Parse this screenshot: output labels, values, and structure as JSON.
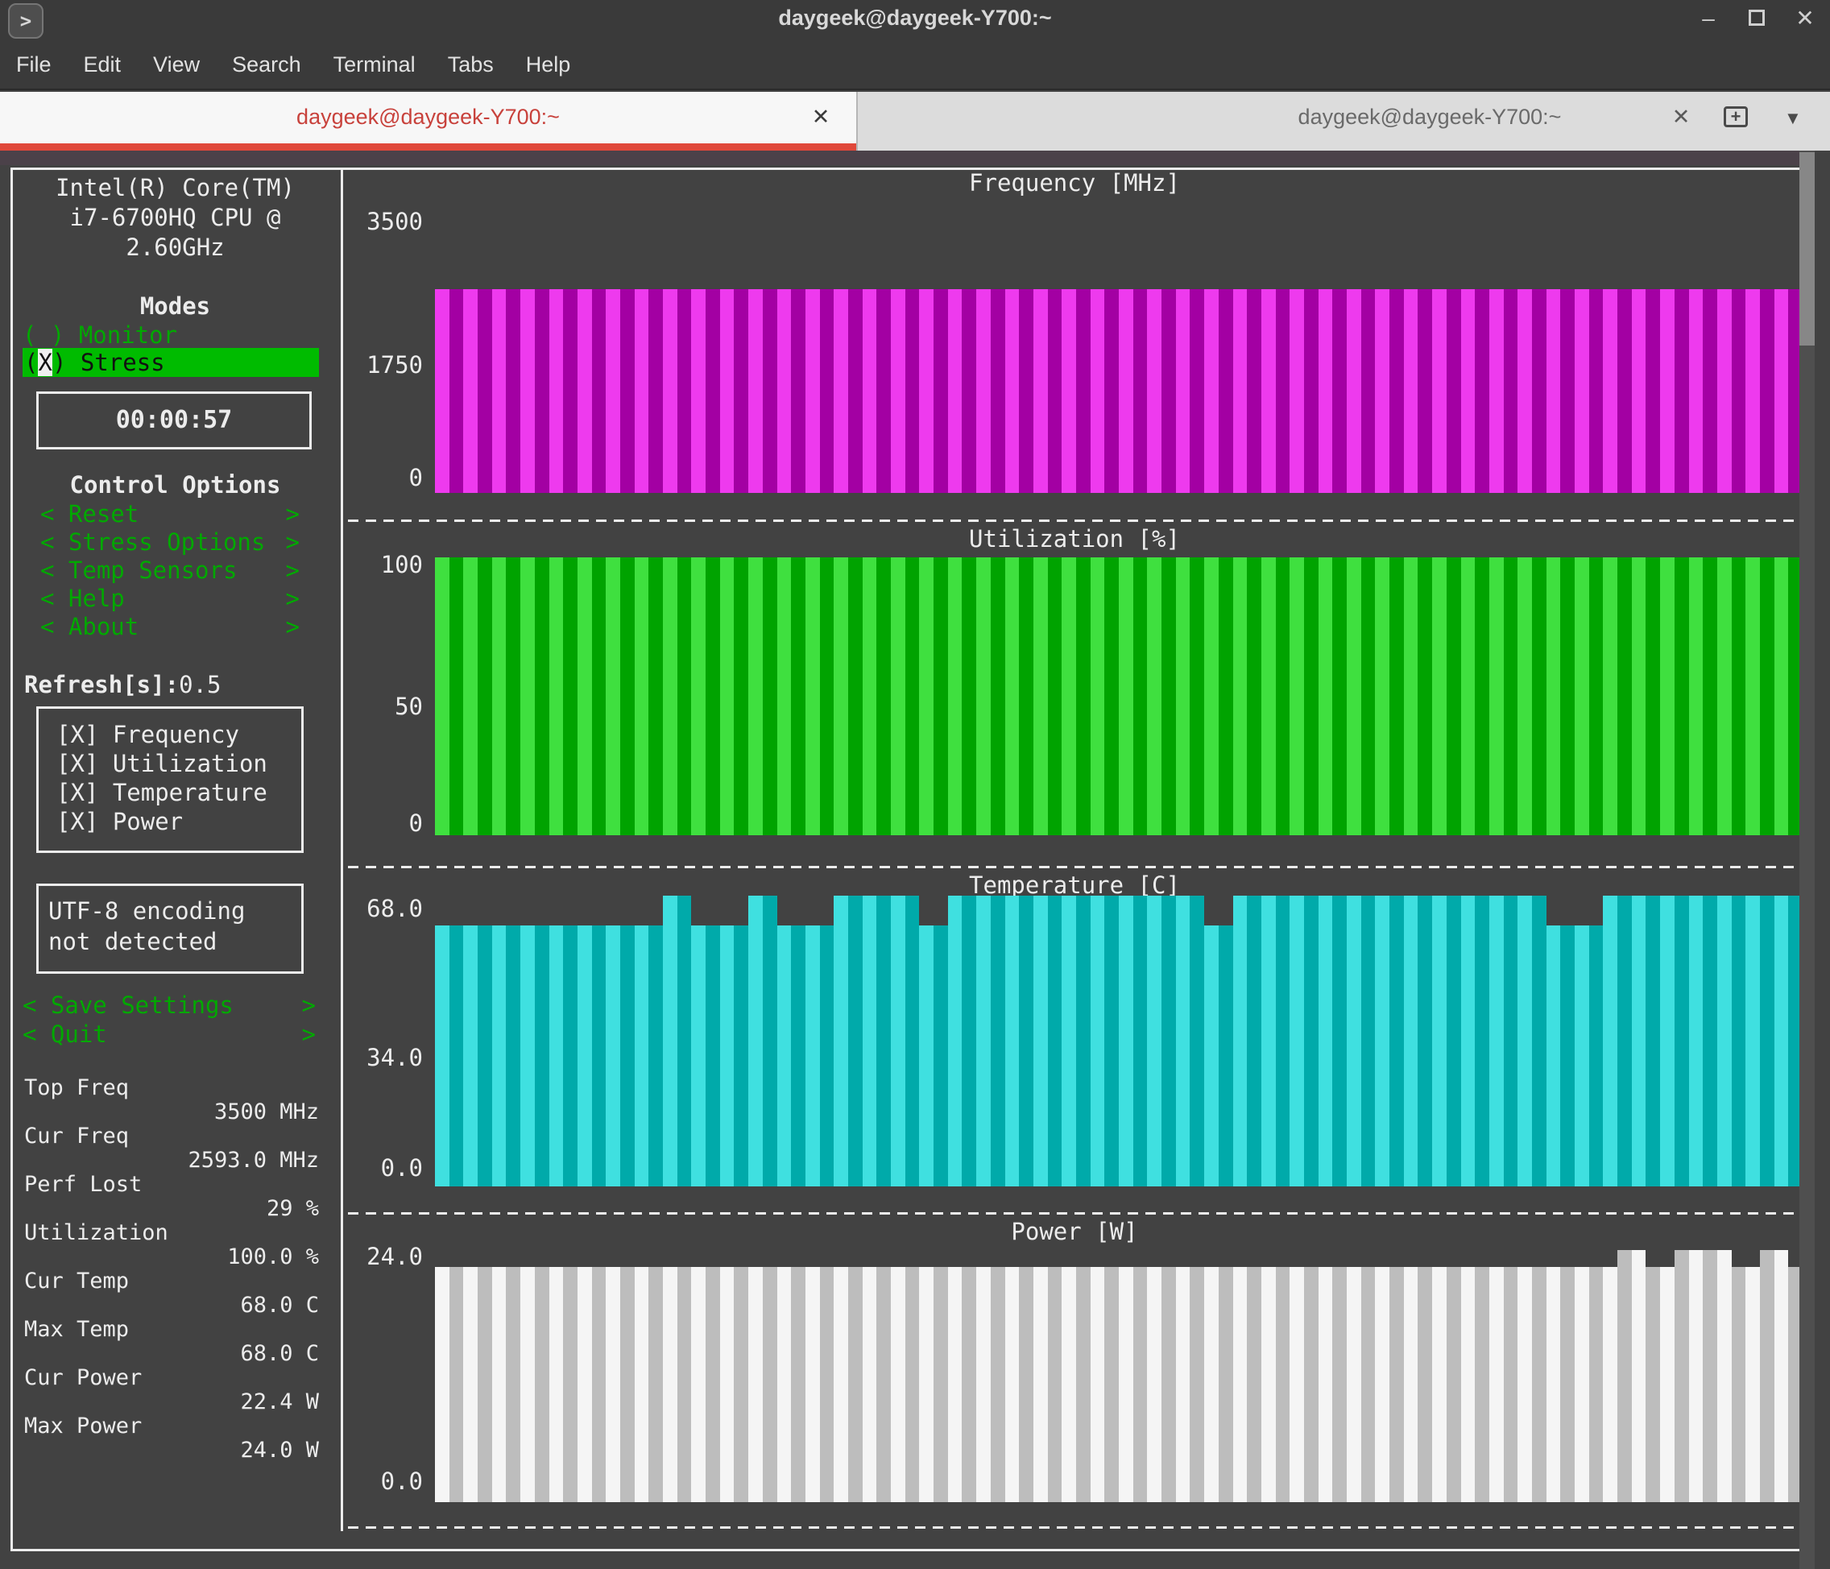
{
  "window": {
    "title": "daygeek@daygeek-Y700:~",
    "controls": {
      "minimize": "–",
      "close": "✕"
    }
  },
  "menu": {
    "items": [
      "File",
      "Edit",
      "View",
      "Search",
      "Terminal",
      "Tabs",
      "Help"
    ]
  },
  "tabs": {
    "active": {
      "title": "daygeek@daygeek-Y700:~",
      "close_icon": "✕"
    },
    "inactive": {
      "title": "daygeek@daygeek-Y700:~",
      "close_icon": "✕"
    },
    "new_tab_icon": "+",
    "dropdown_icon": "▼"
  },
  "app_icon_glyph": ">",
  "sidebar": {
    "cpu_model_lines": [
      "Intel(R) Core(TM)",
      "i7-6700HQ CPU @",
      "2.60GHz"
    ],
    "modes_header": "Modes",
    "monitor_option": "( ) Monitor",
    "stress_prefix": "(",
    "stress_cursor": "X",
    "stress_suffix": ") Stress",
    "stress_timer": "00:00:57",
    "control_header": "Control Options",
    "control_items": [
      "Reset",
      "Stress Options",
      "Temp Sensors",
      "Help",
      "About"
    ],
    "arrow_left": "<",
    "arrow_right": ">",
    "refresh_label": "Refresh[s]:",
    "refresh_value": "0.5",
    "summaries": [
      "[X] Frequency",
      "[X] Utilization",
      "[X] Temperature",
      "[X] Power"
    ],
    "encoding_warning": "UTF-8 encoding not detected",
    "actions": [
      "Save Settings",
      "Quit"
    ],
    "stats": [
      {
        "label": "Top Freq",
        "value": "3500 MHz"
      },
      {
        "label": "Cur Freq",
        "value": "2593.0 MHz"
      },
      {
        "label": "Perf Lost",
        "value": "29 %"
      },
      {
        "label": "Utilization",
        "value": "100.0 %"
      },
      {
        "label": "Cur Temp",
        "value": "68.0 C"
      },
      {
        "label": "Max Temp",
        "value": "68.0 C"
      },
      {
        "label": "Cur Power",
        "value": "22.4 W"
      },
      {
        "label": "Max Power",
        "value": "24.0 W"
      }
    ]
  },
  "chart_data": [
    {
      "type": "bar",
      "title": "Frequency [MHz]",
      "ylim": [
        0,
        3500
      ],
      "yticks": [
        {
          "label": "3500",
          "frac": 0.01
        },
        {
          "label": "1750",
          "frac": 0.53
        },
        {
          "label": "0",
          "frac": 0.94
        }
      ],
      "grid": false,
      "n_samples": 96,
      "values_rle": [
        [
          96,
          2593
        ]
      ],
      "bar_color_bright": "#ee3aee",
      "bar_color_dark": "#a300a3"
    },
    {
      "type": "bar",
      "title": "Utilization [%]",
      "ylim": [
        0,
        100
      ],
      "yticks": [
        {
          "label": "100",
          "frac": 0.02
        },
        {
          "label": "50",
          "frac": 0.53
        },
        {
          "label": "0",
          "frac": 0.95
        }
      ],
      "grid": false,
      "n_samples": 96,
      "values_rle": [
        [
          96,
          100
        ]
      ],
      "bar_color_bright": "#3fe03f",
      "bar_color_dark": "#00a300"
    },
    {
      "type": "bar",
      "title": "Temperature [C]",
      "ylim": [
        0,
        68
      ],
      "yticks": [
        {
          "label": "68.0",
          "frac": 0.04
        },
        {
          "label": "34.0",
          "frac": 0.55
        },
        {
          "label": "0.0",
          "frac": 0.93
        }
      ],
      "grid": false,
      "n_samples": 96,
      "values_rle": [
        [
          16,
          61
        ],
        [
          2,
          68
        ],
        [
          4,
          61
        ],
        [
          2,
          68
        ],
        [
          4,
          61
        ],
        [
          6,
          68
        ],
        [
          2,
          61
        ],
        [
          18,
          68
        ],
        [
          2,
          61
        ],
        [
          22,
          68
        ],
        [
          4,
          61
        ],
        [
          14,
          68
        ]
      ],
      "bar_color_bright": "#3fe0e0",
      "bar_color_dark": "#00aaaa"
    },
    {
      "type": "bar",
      "title": "Power [W]",
      "ylim": [
        0,
        24
      ],
      "yticks": [
        {
          "label": "24.0",
          "frac": 0.02
        },
        {
          "label": "0.0",
          "frac": 0.91
        }
      ],
      "grid": false,
      "n_samples": 96,
      "values_rle": [
        [
          83,
          22.4
        ],
        [
          2,
          24.0
        ],
        [
          2,
          22.4
        ],
        [
          4,
          24.0
        ],
        [
          2,
          22.4
        ],
        [
          2,
          24.0
        ],
        [
          1,
          22.4
        ]
      ],
      "bar_color_bright": "#f5f5f5",
      "bar_color_dark": "#bdbdbd"
    }
  ],
  "colors": {
    "titlebar_bg": "#3a3a3a",
    "terminal_bg": "#424242",
    "tab_active_bg": "#f7f7f7",
    "tab_inactive_bg": "#dcdcdc",
    "tab_accent_red": "#e0483a",
    "tab_text_red": "#c8423c",
    "ui_white": "#ececec",
    "menu_green": "#00a800",
    "highlight_green": "#00bb00"
  }
}
